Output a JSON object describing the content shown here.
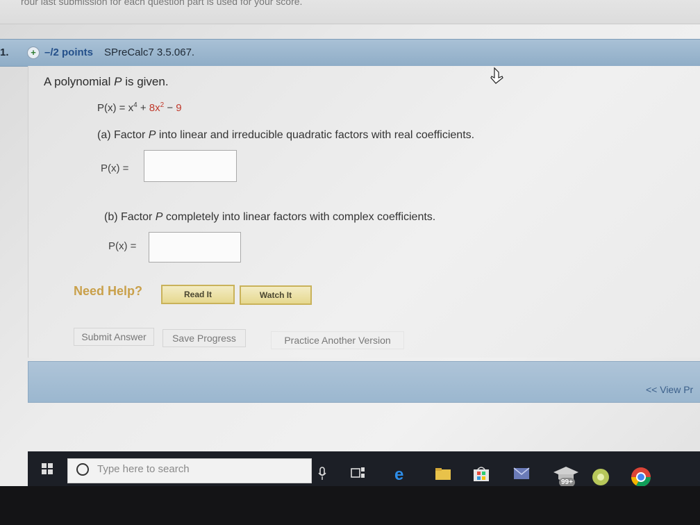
{
  "top_strip": {
    "text": "rour last submission for each question part is used for your score."
  },
  "question": {
    "number": "1.",
    "points": "–/2 points",
    "source": "SPreCalc7 3.5.067."
  },
  "prompt": {
    "before": "A polynomial ",
    "var": "P",
    "after": " is given."
  },
  "formula": {
    "lhs": "P(x) = x",
    "exp1": "4",
    "mid": " + ",
    "term2": "8x",
    "exp2": "2",
    "minus": " − ",
    "const": "9"
  },
  "part_a": {
    "text_before": "(a) Factor ",
    "var": "P",
    "text_after": " into linear and irreducible quadratic factors with real coefficients.",
    "label": "P(x) =",
    "value": ""
  },
  "part_b": {
    "text_before": "(b) Factor ",
    "var": "P",
    "text_after": " completely into linear factors with complex coefficients.",
    "label": "P(x) =",
    "value": ""
  },
  "help": {
    "label": "Need Help?",
    "read_it": "Read It",
    "watch_it": "Watch It"
  },
  "actions": {
    "submit": "Submit Answer",
    "save": "Save Progress",
    "practice": "Practice Another Version"
  },
  "footer": {
    "view_previous": "<< View Pr"
  },
  "taskbar": {
    "search_placeholder": "Type here to search",
    "badge": "99+"
  },
  "colors": {
    "question_bar": "#9bb7cf",
    "points": "#24508a",
    "help": "#c9a04a",
    "help_button": "#e6d88f",
    "coefficient": "#c0392b"
  }
}
